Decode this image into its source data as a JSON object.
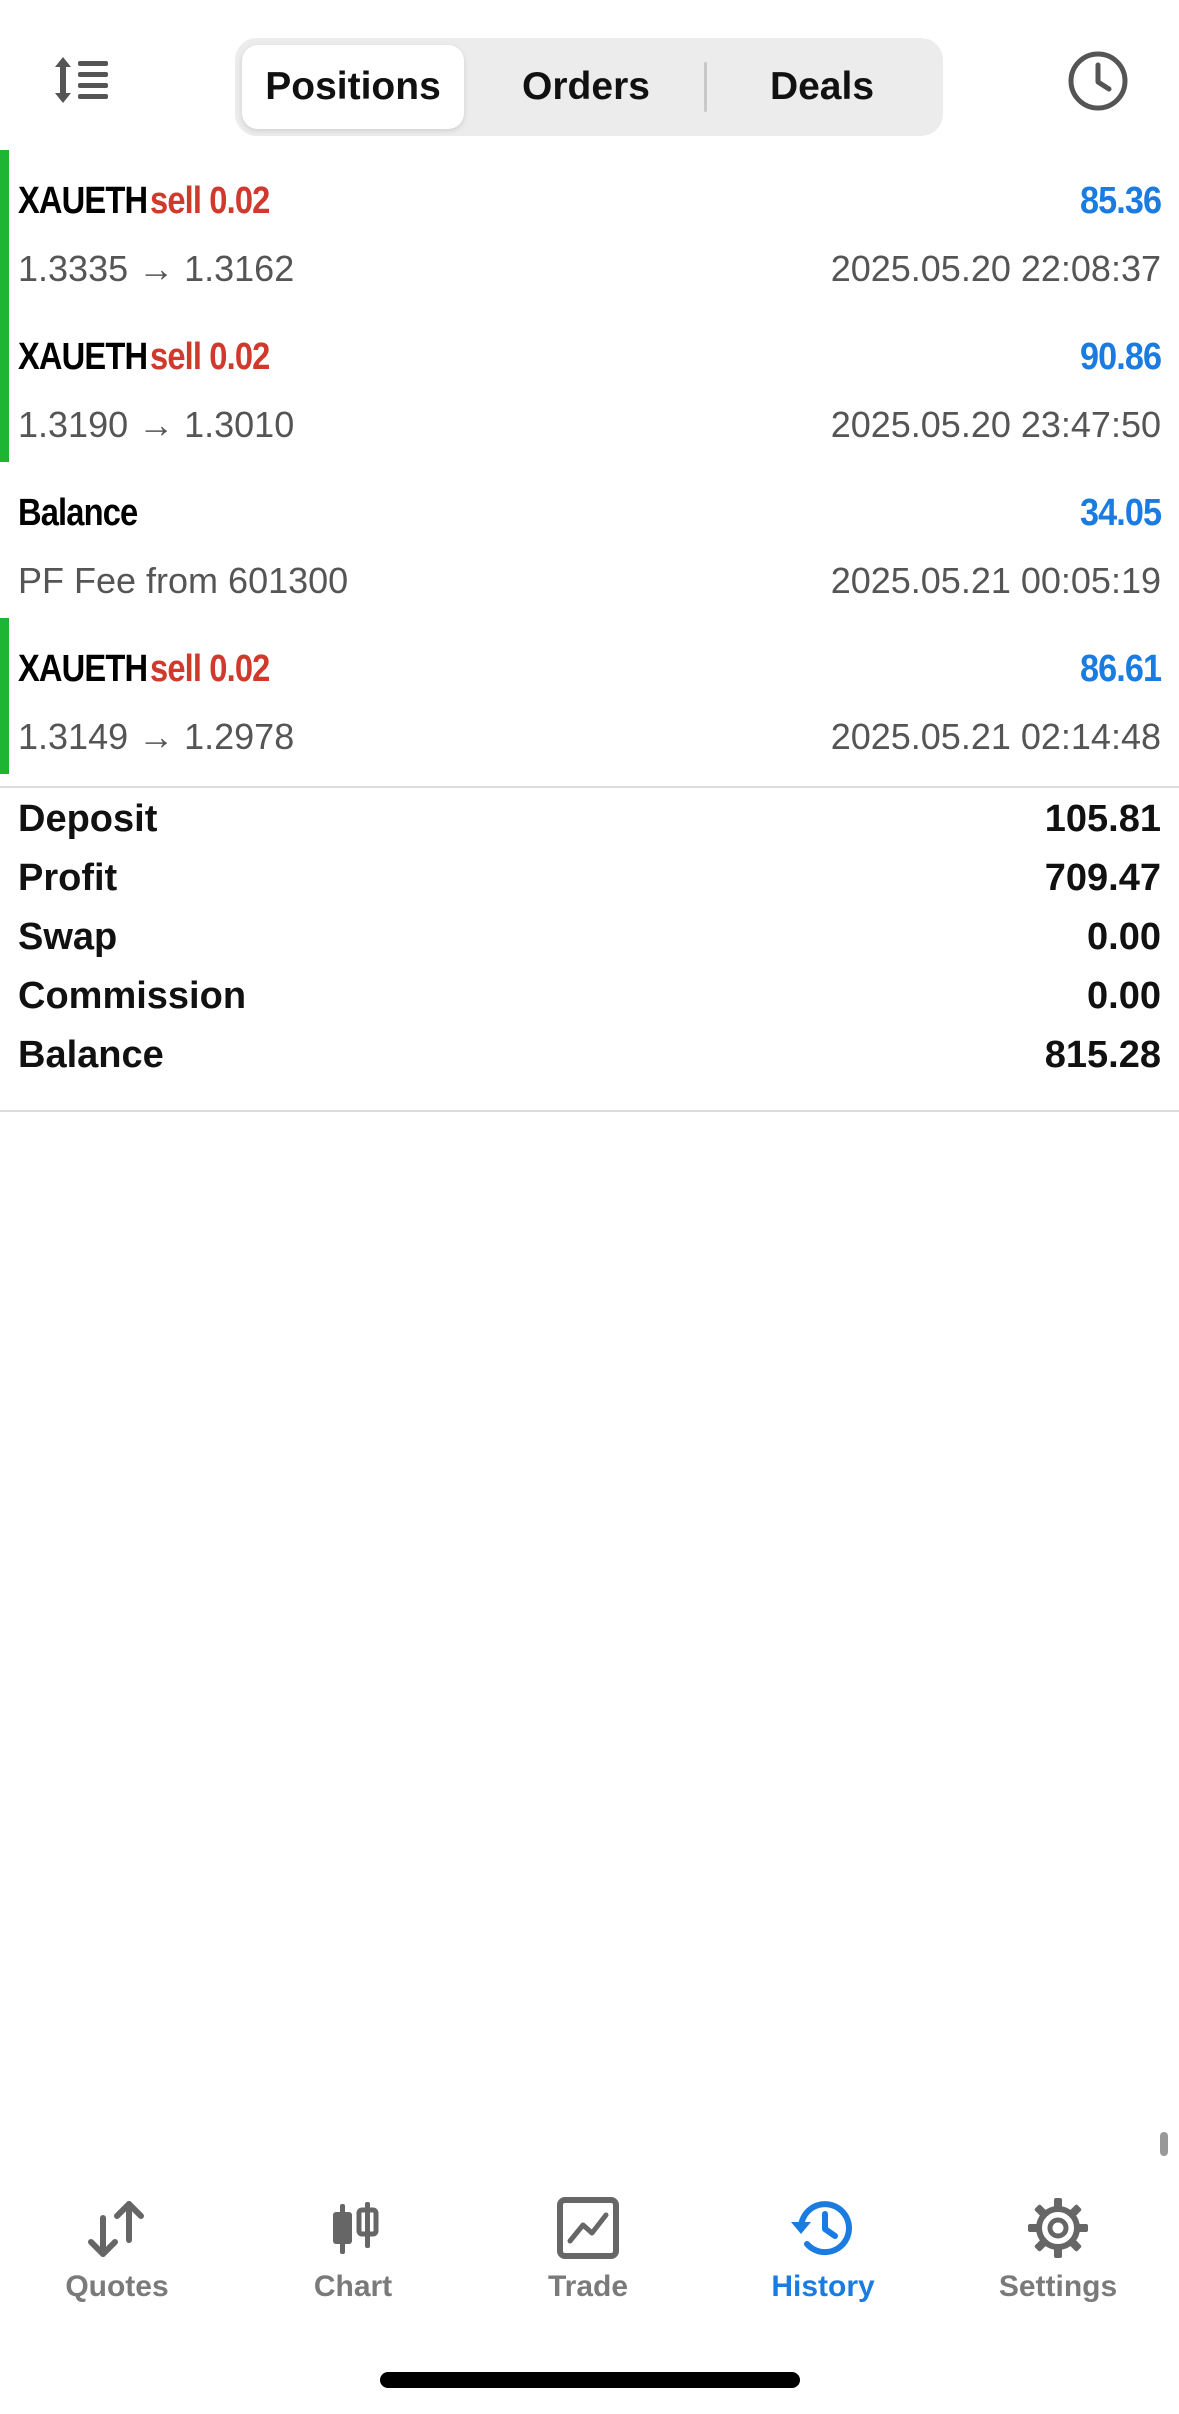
{
  "header": {
    "sort_icon": "sort-lines-icon",
    "tabs": [
      {
        "label": "Positions",
        "selected": true
      },
      {
        "label": "Orders",
        "selected": false
      },
      {
        "label": "Deals",
        "selected": false
      }
    ],
    "clock_icon": "clock-icon"
  },
  "rows": [
    {
      "symbol": "XAUETH",
      "type": "sell 0.02",
      "profit": "85.36",
      "prices": "1.3335 → 1.3162",
      "time": "2025.05.20 22:08:37",
      "bar_color": "#1fb534"
    },
    {
      "symbol": "XAUETH",
      "type": "sell 0.02",
      "profit": "90.86",
      "prices": "1.3190 → 1.3010",
      "time": "2025.05.20 23:47:50",
      "bar_color": "#1fb534"
    },
    {
      "symbol": "Balance",
      "type": "",
      "profit": "34.05",
      "prices": "PF Fee from 601300",
      "time": "2025.05.21 00:05:19",
      "bar_color": ""
    },
    {
      "symbol": "XAUETH",
      "type": "sell 0.02",
      "profit": "86.61",
      "prices": "1.3149 → 1.2978",
      "time": "2025.05.21 02:14:48",
      "bar_color": "#1fb534"
    }
  ],
  "summary": [
    {
      "label": "Deposit",
      "value": "105.81"
    },
    {
      "label": "Profit",
      "value": "709.47"
    },
    {
      "label": "Swap",
      "value": "0.00"
    },
    {
      "label": "Commission",
      "value": "0.00"
    },
    {
      "label": "Balance",
      "value": "815.28"
    }
  ],
  "tabbar": [
    {
      "label": "Quotes",
      "icon": "quotes-arrows-icon",
      "active": false
    },
    {
      "label": "Chart",
      "icon": "candlestick-chart-icon",
      "active": false
    },
    {
      "label": "Trade",
      "icon": "trade-chart-icon",
      "active": false
    },
    {
      "label": "History",
      "icon": "history-clock-icon",
      "active": true
    },
    {
      "label": "Settings",
      "icon": "gear-icon",
      "active": false
    }
  ],
  "colors": {
    "accent": "#1a7be0",
    "sell": "#cf3a2c",
    "profit_bar": "#1fb534",
    "loss_mark": "#e05a4a",
    "tab_inactive": "#7a7a7a"
  }
}
